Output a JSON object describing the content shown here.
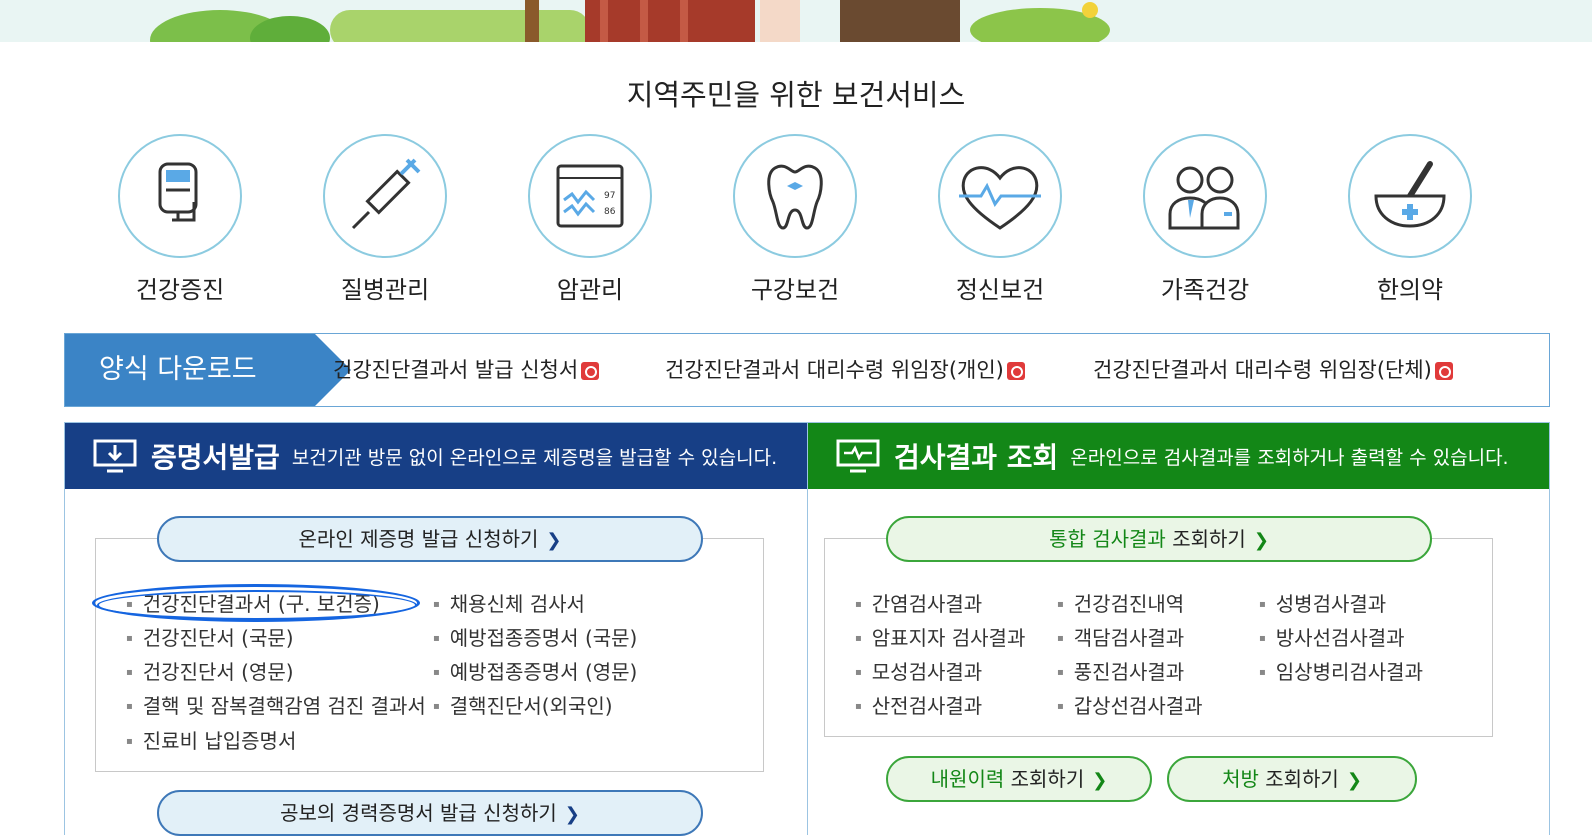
{
  "page": {
    "section_title": "지역주민을 위한 보건서비스"
  },
  "services": [
    {
      "label": "건강증진",
      "icon": "iv-bag-icon"
    },
    {
      "label": "질병관리",
      "icon": "syringe-icon"
    },
    {
      "label": "암관리",
      "icon": "monitor-chart-icon"
    },
    {
      "label": "구강보건",
      "icon": "tooth-icon"
    },
    {
      "label": "정신보건",
      "icon": "heart-pulse-icon"
    },
    {
      "label": "가족건강",
      "icon": "family-icon"
    },
    {
      "label": "한의약",
      "icon": "mortar-pestle-icon"
    }
  ],
  "forms": {
    "tag": "양식 다운로드",
    "links": [
      "건강진단결과서 발급 신청서",
      "건강진단결과서 대리수령 위임장(개인)",
      "건강진단결과서 대리수령 위임장(단체)"
    ]
  },
  "certificate": {
    "title": "증명서발급",
    "desc": "보건기관 방문 없이 온라인으로 제증명을 발급할 수 있습니다.",
    "apply_button": "온라인 제증명 발급 신청하기",
    "col1": [
      "건강진단결과서 (구. 보건증)",
      "건강진단서 (국문)",
      "건강진단서 (영문)",
      "결핵 및 잠복결핵감염 검진 결과서",
      "진료비 납입증명서"
    ],
    "col2": [
      "채용신체 검사서",
      "예방접종증명서 (국문)",
      "예방접종증명서 (영문)",
      "결핵진단서(외국인)"
    ],
    "career_button": "공보의 경력증명서 발급 신청하기"
  },
  "results": {
    "title": "검사결과 조회",
    "desc": "온라인으로 검사결과를 조회하거나 출력할 수 있습니다.",
    "integrated_em": "통합 검사결과",
    "integrated_rest": "조회하기",
    "col1": [
      "간염검사결과",
      "암표지자 검사결과",
      "모성검사결과",
      "산전검사결과"
    ],
    "col2": [
      "건강검진내역",
      "객담검사결과",
      "풍진검사결과",
      "갑상선검사결과"
    ],
    "col3": [
      "성병검사결과",
      "방사선검사결과",
      "임상병리검사결과"
    ],
    "visit_em": "내원이력",
    "visit_rest": "조회하기",
    "rx_em": "처방",
    "rx_rest": "조회하기"
  },
  "colors": {
    "accent_blue": "#173f86",
    "accent_green": "#138717",
    "tag_blue": "#3b84c6",
    "icon_border": "#8ccbe0"
  }
}
